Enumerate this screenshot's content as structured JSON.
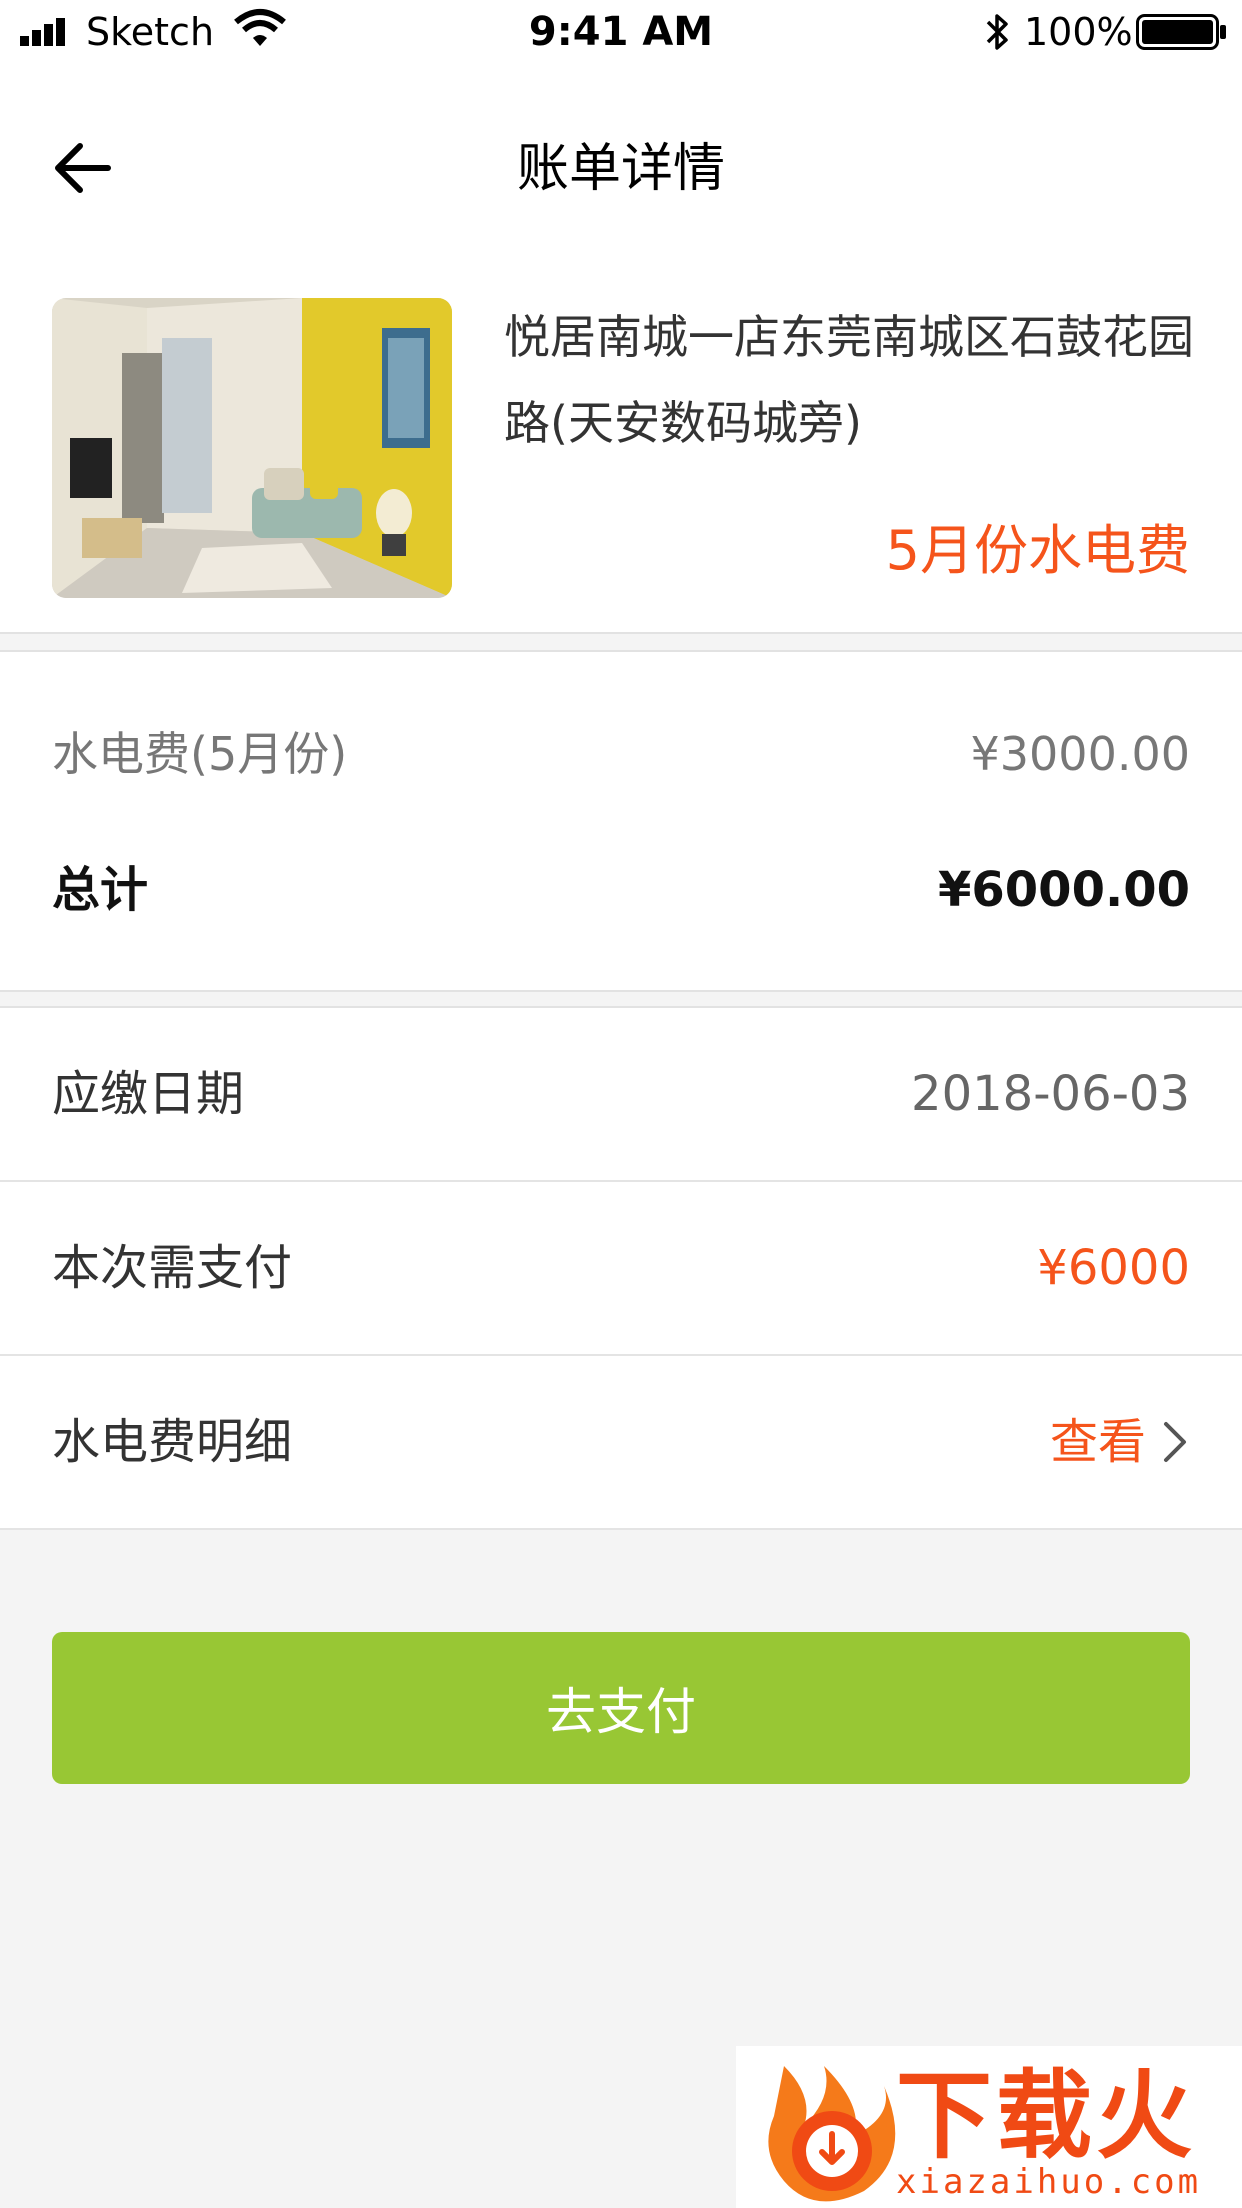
{
  "status_bar": {
    "carrier": "Sketch",
    "time": "9:41 AM",
    "battery": "100%"
  },
  "nav": {
    "title": "账单详情"
  },
  "property": {
    "address": "悦居南城一店东莞南城区石鼓花园路(天安数码城旁)",
    "bill_name": "5月份水电费"
  },
  "amounts": {
    "fee_label": "水电费(5月份)",
    "fee_value": "¥3000.00",
    "total_label": "总计",
    "total_value": "¥6000.00"
  },
  "info": {
    "due_label": "应缴日期",
    "due_value": "2018-06-03",
    "pay_label": "本次需支付",
    "pay_value": "¥6000",
    "detail_label": "水电费明细",
    "detail_link": "查看"
  },
  "actions": {
    "pay_button": "去支付"
  },
  "watermark": {
    "brand": "下载火",
    "domain": "xiazaihuo.com"
  },
  "colors": {
    "accent": "#f5541b",
    "primary_button": "#98c734",
    "background": "#f4f4f4"
  }
}
